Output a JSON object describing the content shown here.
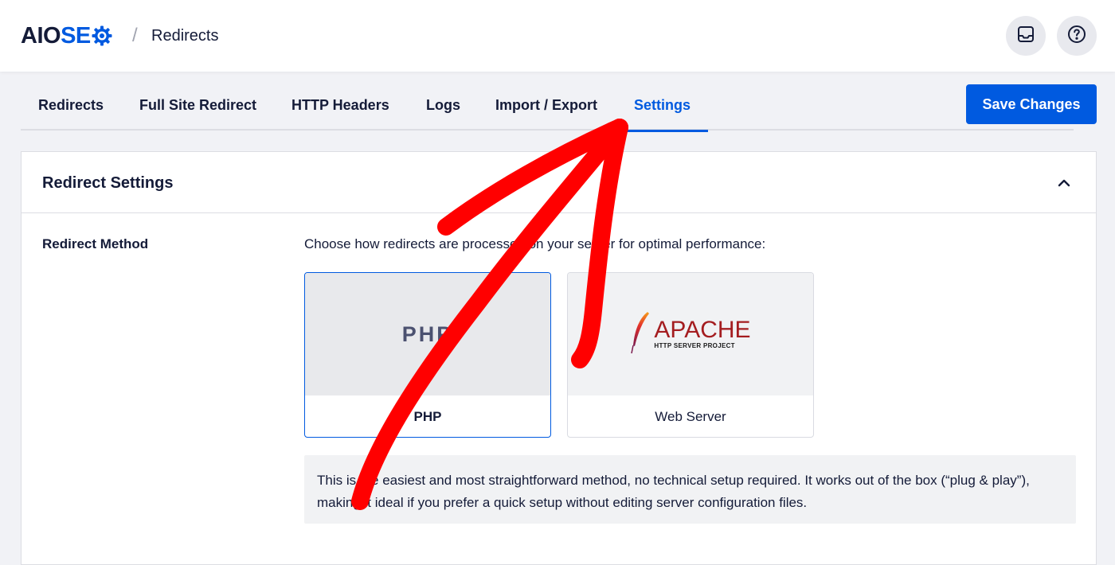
{
  "header": {
    "logo_aio": "AIO",
    "logo_seo": "SE",
    "separator": "/",
    "page_title": "Redirects",
    "icons": [
      "inbox-icon",
      "help-circle-icon"
    ]
  },
  "tabs": [
    {
      "label": "Redirects"
    },
    {
      "label": "Full Site Redirect"
    },
    {
      "label": "HTTP Headers"
    },
    {
      "label": "Logs"
    },
    {
      "label": "Import / Export"
    },
    {
      "label": "Settings",
      "active": true
    }
  ],
  "actions": {
    "save_label": "Save Changes"
  },
  "card": {
    "title": "Redirect Settings",
    "redirect_method": {
      "label": "Redirect Method",
      "description": "Choose how redirects are processed on your server for optimal performance:",
      "options": [
        {
          "logo_text": "PHP",
          "label": "PHP",
          "selected": true
        },
        {
          "logo_text": "APACHE",
          "logo_subtext": "HTTP SERVER PROJECT",
          "label": "Web Server",
          "selected": false
        }
      ],
      "info": "This is the easiest and most straightforward method, no technical setup required. It works out of the box (“plug & play”), making it ideal if you prefer a quick setup without editing server configuration files."
    }
  },
  "colors": {
    "accent": "#005ae0",
    "text": "#141b38",
    "annotation_arrow": "#ff0000",
    "apache_red": "#a41d20"
  }
}
